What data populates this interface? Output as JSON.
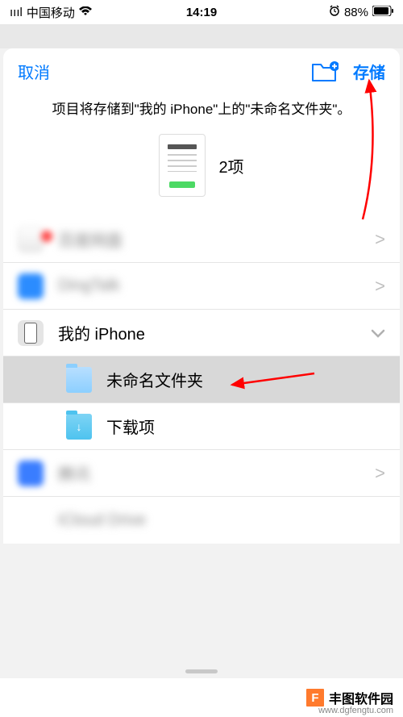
{
  "statusBar": {
    "signal": "ıııl",
    "carrier": "中国移动",
    "time": "14:19",
    "battery": "88%"
  },
  "header": {
    "cancel": "取消",
    "save": "存储"
  },
  "description": "项目将存储到\"我的 iPhone\"上的\"未命名文件夹\"。",
  "preview": {
    "count": "2项"
  },
  "rows": [
    {
      "label": "百度网盘",
      "blur": true,
      "chevron": ">"
    },
    {
      "label": "DingTalk",
      "blur": true,
      "chevron": ">"
    },
    {
      "label": "我的 iPhone",
      "blur": false,
      "chevron": "⌄"
    },
    {
      "label": "未命名文件夹",
      "blur": false,
      "indent": true,
      "selected": true
    },
    {
      "label": "下载项",
      "blur": false,
      "indent": true
    },
    {
      "label": "腾讯",
      "blur": true,
      "chevron": ">"
    },
    {
      "label": "iCloud Drive",
      "blur": true
    }
  ],
  "watermark": {
    "brand": "丰图软件园",
    "domain": "www.dgfengtu.com"
  }
}
